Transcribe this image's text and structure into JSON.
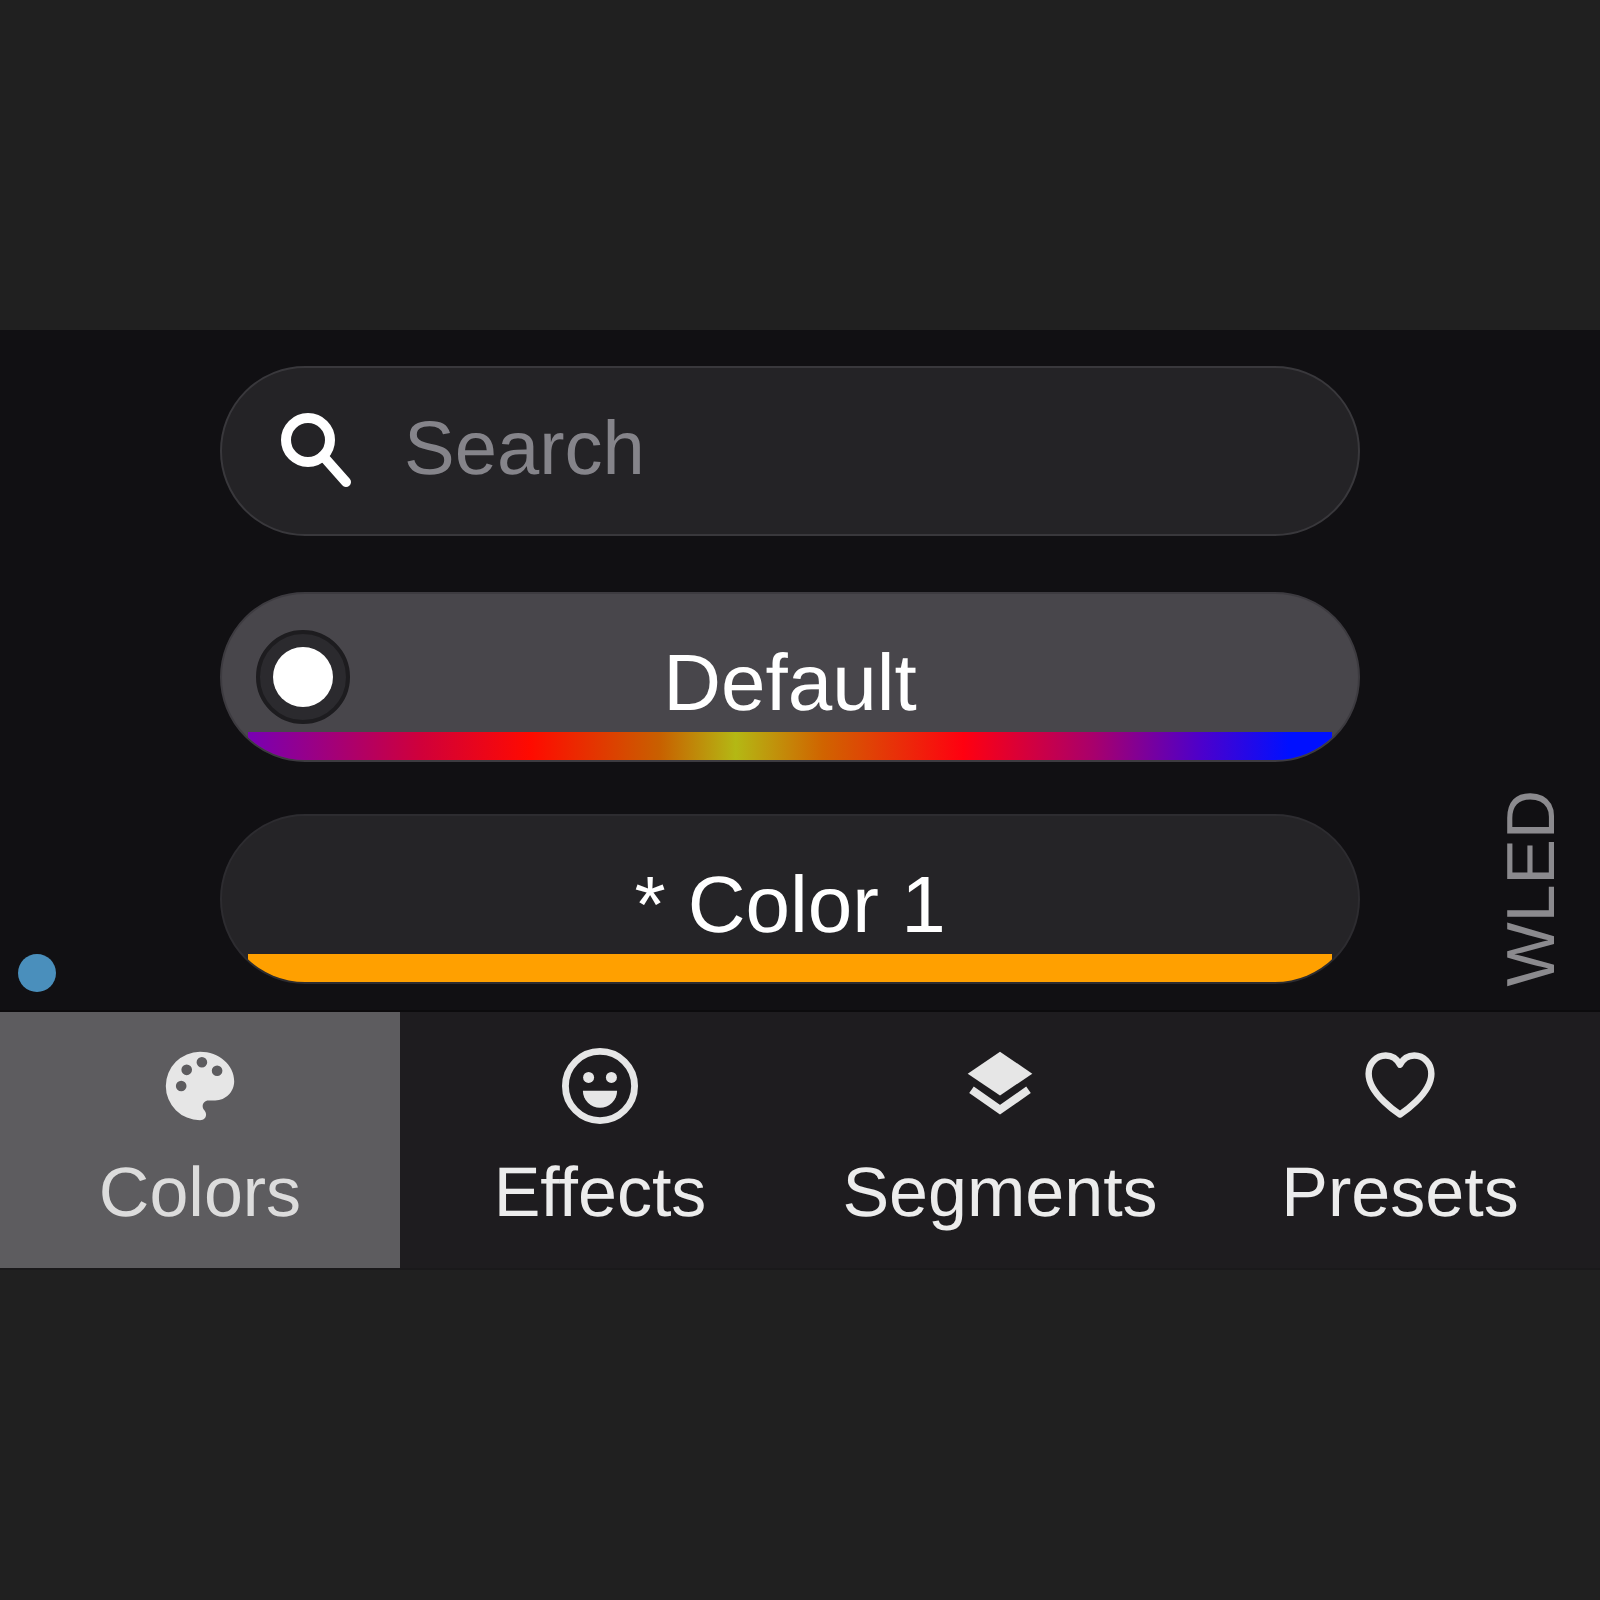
{
  "search": {
    "placeholder": "Search"
  },
  "palettes": [
    {
      "name": "Default",
      "selected": true,
      "kind": "gradient"
    },
    {
      "name": "* Color 1",
      "selected": false,
      "kind": "solid",
      "color": "#ffa000"
    }
  ],
  "brand": "WLED",
  "tabs": [
    {
      "label": "Colors",
      "selected": true
    },
    {
      "label": "Effects",
      "selected": false
    },
    {
      "label": "Segments",
      "selected": false
    },
    {
      "label": "Presets",
      "selected": false
    }
  ]
}
